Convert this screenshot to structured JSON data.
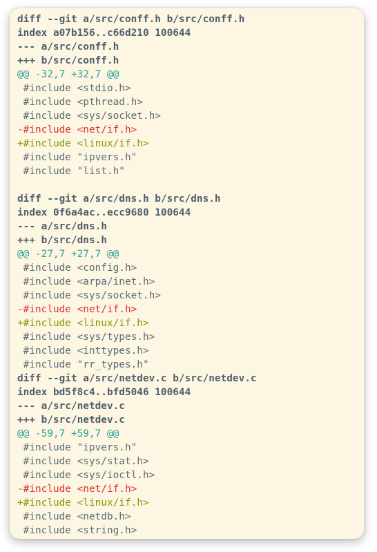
{
  "terminal": {
    "lines": [
      {
        "type": "meta",
        "text": "diff --git a/src/conff.h b/src/conff.h"
      },
      {
        "type": "meta",
        "text": "index a07b156..c66d210 100644"
      },
      {
        "type": "meta",
        "text": "--- a/src/conff.h"
      },
      {
        "type": "meta",
        "text": "+++ b/src/conff.h"
      },
      {
        "type": "hunk",
        "text": "@@ -32,7 +32,7 @@"
      },
      {
        "type": "ctx",
        "text": " #include <stdio.h>"
      },
      {
        "type": "ctx",
        "text": " #include <pthread.h>"
      },
      {
        "type": "ctx",
        "text": " #include <sys/socket.h>"
      },
      {
        "type": "del",
        "text": "-#include <net/if.h>"
      },
      {
        "type": "add",
        "text": "+#include <linux/if.h>"
      },
      {
        "type": "ctx",
        "text": " #include \"ipvers.h\""
      },
      {
        "type": "ctx",
        "text": " #include \"list.h\""
      },
      {
        "type": "blank",
        "text": ""
      },
      {
        "type": "meta",
        "text": "diff --git a/src/dns.h b/src/dns.h"
      },
      {
        "type": "meta",
        "text": "index 0f6a4ac..ecc9680 100644"
      },
      {
        "type": "meta",
        "text": "--- a/src/dns.h"
      },
      {
        "type": "meta",
        "text": "+++ b/src/dns.h"
      },
      {
        "type": "hunk",
        "text": "@@ -27,7 +27,7 @@"
      },
      {
        "type": "ctx",
        "text": " #include <config.h>"
      },
      {
        "type": "ctx",
        "text": " #include <arpa/inet.h>"
      },
      {
        "type": "ctx",
        "text": " #include <sys/socket.h>"
      },
      {
        "type": "del",
        "text": "-#include <net/if.h>"
      },
      {
        "type": "add",
        "text": "+#include <linux/if.h>"
      },
      {
        "type": "ctx",
        "text": " #include <sys/types.h>"
      },
      {
        "type": "ctx",
        "text": " #include <inttypes.h>"
      },
      {
        "type": "ctx",
        "text": " #include \"rr_types.h\""
      },
      {
        "type": "meta",
        "text": "diff --git a/src/netdev.c b/src/netdev.c"
      },
      {
        "type": "meta",
        "text": "index bd5f8c4..bfd5046 100644"
      },
      {
        "type": "meta",
        "text": "--- a/src/netdev.c"
      },
      {
        "type": "meta",
        "text": "+++ b/src/netdev.c"
      },
      {
        "type": "hunk",
        "text": "@@ -59,7 +59,7 @@"
      },
      {
        "type": "ctx",
        "text": " #include \"ipvers.h\""
      },
      {
        "type": "ctx",
        "text": " #include <sys/stat.h>"
      },
      {
        "type": "ctx",
        "text": " #include <sys/ioctl.h>"
      },
      {
        "type": "del",
        "text": "-#include <net/if.h>"
      },
      {
        "type": "add",
        "text": "+#include <linux/if.h>"
      },
      {
        "type": "ctx",
        "text": " #include <netdb.h>"
      },
      {
        "type": "ctx",
        "text": " #include <string.h>"
      }
    ]
  },
  "colors": {
    "background": "#fdf6e3",
    "meta": "#4f5f6a",
    "hunk": "#2aa198",
    "deleted": "#dc322f",
    "added": "#859900",
    "context": "#586e75"
  }
}
